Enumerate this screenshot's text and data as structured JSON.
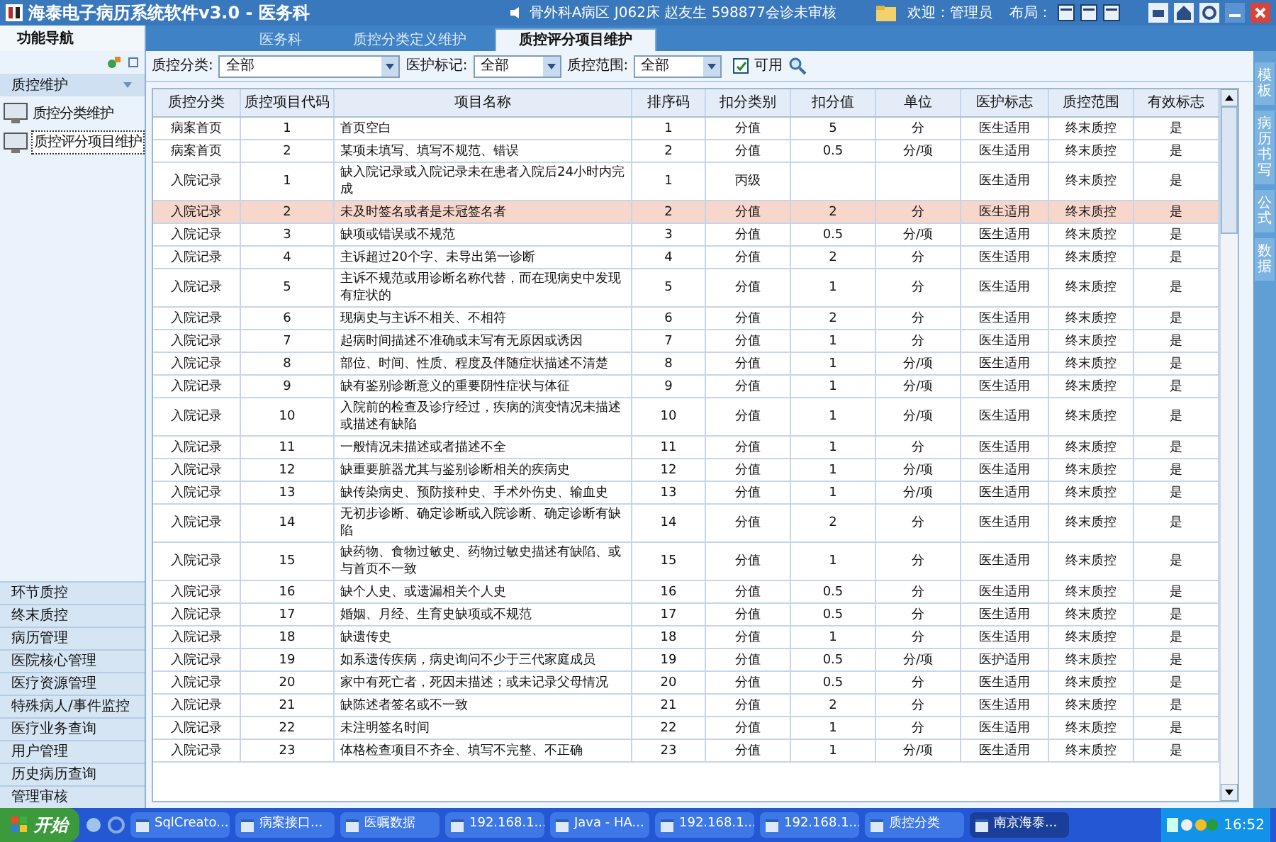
{
  "window": {
    "title": "海泰电子病历系统软件v3.0 - 医务科",
    "patient": "骨外科A病区  J062床  赵友生  598877会诊未审核",
    "welcome": "欢迎：管理员",
    "layout_label": "布局："
  },
  "sidebar": {
    "tab": "功能导航",
    "section": "质控维护",
    "items": [
      {
        "label": "质控分类维护",
        "selected": false
      },
      {
        "label": "质控评分项目维护",
        "selected": true
      }
    ],
    "groups": [
      "环节质控",
      "终末质控",
      "病历管理",
      "医院核心管理",
      "医疗资源管理",
      "特殊病人/事件监控",
      "医疗业务查询",
      "用户管理",
      "历史病历查询",
      "管理审核"
    ]
  },
  "tabs": [
    {
      "label": "医务科",
      "selected": false
    },
    {
      "label": "质控分类定义维护",
      "selected": false
    },
    {
      "label": "质控评分项目维护",
      "selected": true
    }
  ],
  "filters": [
    {
      "label": "质控分类:",
      "value": "全部"
    },
    {
      "label": "医护标记:",
      "value": "全部"
    },
    {
      "label": "质控范围:",
      "value": "全部"
    }
  ],
  "available": {
    "label": "可用",
    "checked": true
  },
  "table": {
    "columns": [
      "质控分类",
      "质控项目代码",
      "项目名称",
      "排序码",
      "扣分类别",
      "扣分值",
      "单位",
      "医护标志",
      "质控范围",
      "有效标志"
    ],
    "rows": [
      {
        "cells": [
          "病案首页",
          "1",
          "首页空白",
          "1",
          "分值",
          "5",
          "分",
          "医生适用",
          "终末质控",
          "是"
        ],
        "selected": false
      },
      {
        "cells": [
          "病案首页",
          "2",
          "某项未填写、填写不规范、错误",
          "2",
          "分值",
          "0.5",
          "分/项",
          "医生适用",
          "终末质控",
          "是"
        ],
        "selected": false
      },
      {
        "cells": [
          "入院记录",
          "1",
          "缺入院记录或入院记录未在患者入院后24小时内完成",
          "1",
          "丙级",
          "",
          "",
          "医生适用",
          "终末质控",
          "是"
        ],
        "selected": false
      },
      {
        "cells": [
          "入院记录",
          "2",
          "未及时签名或者是未冠签名者",
          "2",
          "分值",
          "2",
          "分",
          "医生适用",
          "终末质控",
          "是"
        ],
        "selected": true
      },
      {
        "cells": [
          "入院记录",
          "3",
          "缺项或错误或不规范",
          "3",
          "分值",
          "0.5",
          "分/项",
          "医生适用",
          "终末质控",
          "是"
        ],
        "selected": false
      },
      {
        "cells": [
          "入院记录",
          "4",
          "主诉超过20个字、未导出第一诊断",
          "4",
          "分值",
          "2",
          "分",
          "医生适用",
          "终末质控",
          "是"
        ],
        "selected": false
      },
      {
        "cells": [
          "入院记录",
          "5",
          "主诉不规范或用诊断名称代替，而在现病史中发现有症状的",
          "5",
          "分值",
          "1",
          "分",
          "医生适用",
          "终末质控",
          "是"
        ],
        "selected": false
      },
      {
        "cells": [
          "入院记录",
          "6",
          "现病史与主诉不相关、不相符",
          "6",
          "分值",
          "2",
          "分",
          "医生适用",
          "终末质控",
          "是"
        ],
        "selected": false
      },
      {
        "cells": [
          "入院记录",
          "7",
          "起病时间描述不准确或未写有无原因或诱因",
          "7",
          "分值",
          "1",
          "分",
          "医生适用",
          "终末质控",
          "是"
        ],
        "selected": false
      },
      {
        "cells": [
          "入院记录",
          "8",
          "部位、时间、性质、程度及伴随症状描述不清楚",
          "8",
          "分值",
          "1",
          "分/项",
          "医生适用",
          "终末质控",
          "是"
        ],
        "selected": false
      },
      {
        "cells": [
          "入院记录",
          "9",
          "缺有鉴别诊断意义的重要阴性症状与体征",
          "9",
          "分值",
          "1",
          "分/项",
          "医生适用",
          "终末质控",
          "是"
        ],
        "selected": false
      },
      {
        "cells": [
          "入院记录",
          "10",
          "入院前的检查及诊疗经过，疾病的演变情况未描述或描述有缺陷",
          "10",
          "分值",
          "1",
          "分/项",
          "医生适用",
          "终末质控",
          "是"
        ],
        "selected": false
      },
      {
        "cells": [
          "入院记录",
          "11",
          "一般情况未描述或者描述不全",
          "11",
          "分值",
          "1",
          "分",
          "医生适用",
          "终末质控",
          "是"
        ],
        "selected": false
      },
      {
        "cells": [
          "入院记录",
          "12",
          "缺重要脏器尤其与鉴别诊断相关的疾病史",
          "12",
          "分值",
          "1",
          "分/项",
          "医生适用",
          "终末质控",
          "是"
        ],
        "selected": false
      },
      {
        "cells": [
          "入院记录",
          "13",
          "缺传染病史、预防接种史、手术外伤史、输血史",
          "13",
          "分值",
          "1",
          "分/项",
          "医生适用",
          "终末质控",
          "是"
        ],
        "selected": false
      },
      {
        "cells": [
          "入院记录",
          "14",
          "无初步诊断、确定诊断或入院诊断、确定诊断有缺陷",
          "14",
          "分值",
          "2",
          "分",
          "医生适用",
          "终末质控",
          "是"
        ],
        "selected": false
      },
      {
        "cells": [
          "入院记录",
          "15",
          "缺药物、食物过敏史、药物过敏史描述有缺陷、或与首页不一致",
          "15",
          "分值",
          "1",
          "分",
          "医生适用",
          "终末质控",
          "是"
        ],
        "selected": false
      },
      {
        "cells": [
          "入院记录",
          "16",
          "缺个人史、或遗漏相关个人史",
          "16",
          "分值",
          "0.5",
          "分",
          "医生适用",
          "终末质控",
          "是"
        ],
        "selected": false
      },
      {
        "cells": [
          "入院记录",
          "17",
          "婚姻、月经、生育史缺项或不规范",
          "17",
          "分值",
          "0.5",
          "分",
          "医生适用",
          "终末质控",
          "是"
        ],
        "selected": false
      },
      {
        "cells": [
          "入院记录",
          "18",
          "缺遗传史",
          "18",
          "分值",
          "1",
          "分",
          "医生适用",
          "终末质控",
          "是"
        ],
        "selected": false
      },
      {
        "cells": [
          "入院记录",
          "19",
          "如系遗传疾病，病史询问不少于三代家庭成员",
          "19",
          "分值",
          "0.5",
          "分/项",
          "医护适用",
          "终末质控",
          "是"
        ],
        "selected": false
      },
      {
        "cells": [
          "入院记录",
          "20",
          "家中有死亡者，死因未描述；或未记录父母情况",
          "20",
          "分值",
          "0.5",
          "分",
          "医生适用",
          "终末质控",
          "是"
        ],
        "selected": false
      },
      {
        "cells": [
          "入院记录",
          "21",
          "缺陈述者签名或不一致",
          "21",
          "分值",
          "2",
          "分",
          "医生适用",
          "终末质控",
          "是"
        ],
        "selected": false
      },
      {
        "cells": [
          "入院记录",
          "22",
          "未注明签名时间",
          "22",
          "分值",
          "1",
          "分",
          "医生适用",
          "终末质控",
          "是"
        ],
        "selected": false
      },
      {
        "cells": [
          "入院记录",
          "23",
          "体格检查项目不齐全、填写不完整、不正确",
          "23",
          "分值",
          "1",
          "分/项",
          "医生适用",
          "终末质控",
          "是"
        ],
        "selected": false
      }
    ]
  },
  "right_tabs": [
    "模板",
    "病历书写",
    "公式",
    "数据"
  ],
  "taskbar": {
    "start": "开始",
    "items": [
      {
        "label": "SqlCreato...",
        "selected": false
      },
      {
        "label": "病案接口...",
        "selected": false
      },
      {
        "label": "医嘱数据",
        "selected": false
      },
      {
        "label": "192.168.1...",
        "selected": false
      },
      {
        "label": "Java - HA...",
        "selected": false
      },
      {
        "label": "192.168.1...",
        "selected": false
      },
      {
        "label": "192.168.1...",
        "selected": false
      },
      {
        "label": "质控分类",
        "selected": false
      },
      {
        "label": "南京海泰...",
        "selected": true
      }
    ],
    "clock": "16:52"
  }
}
